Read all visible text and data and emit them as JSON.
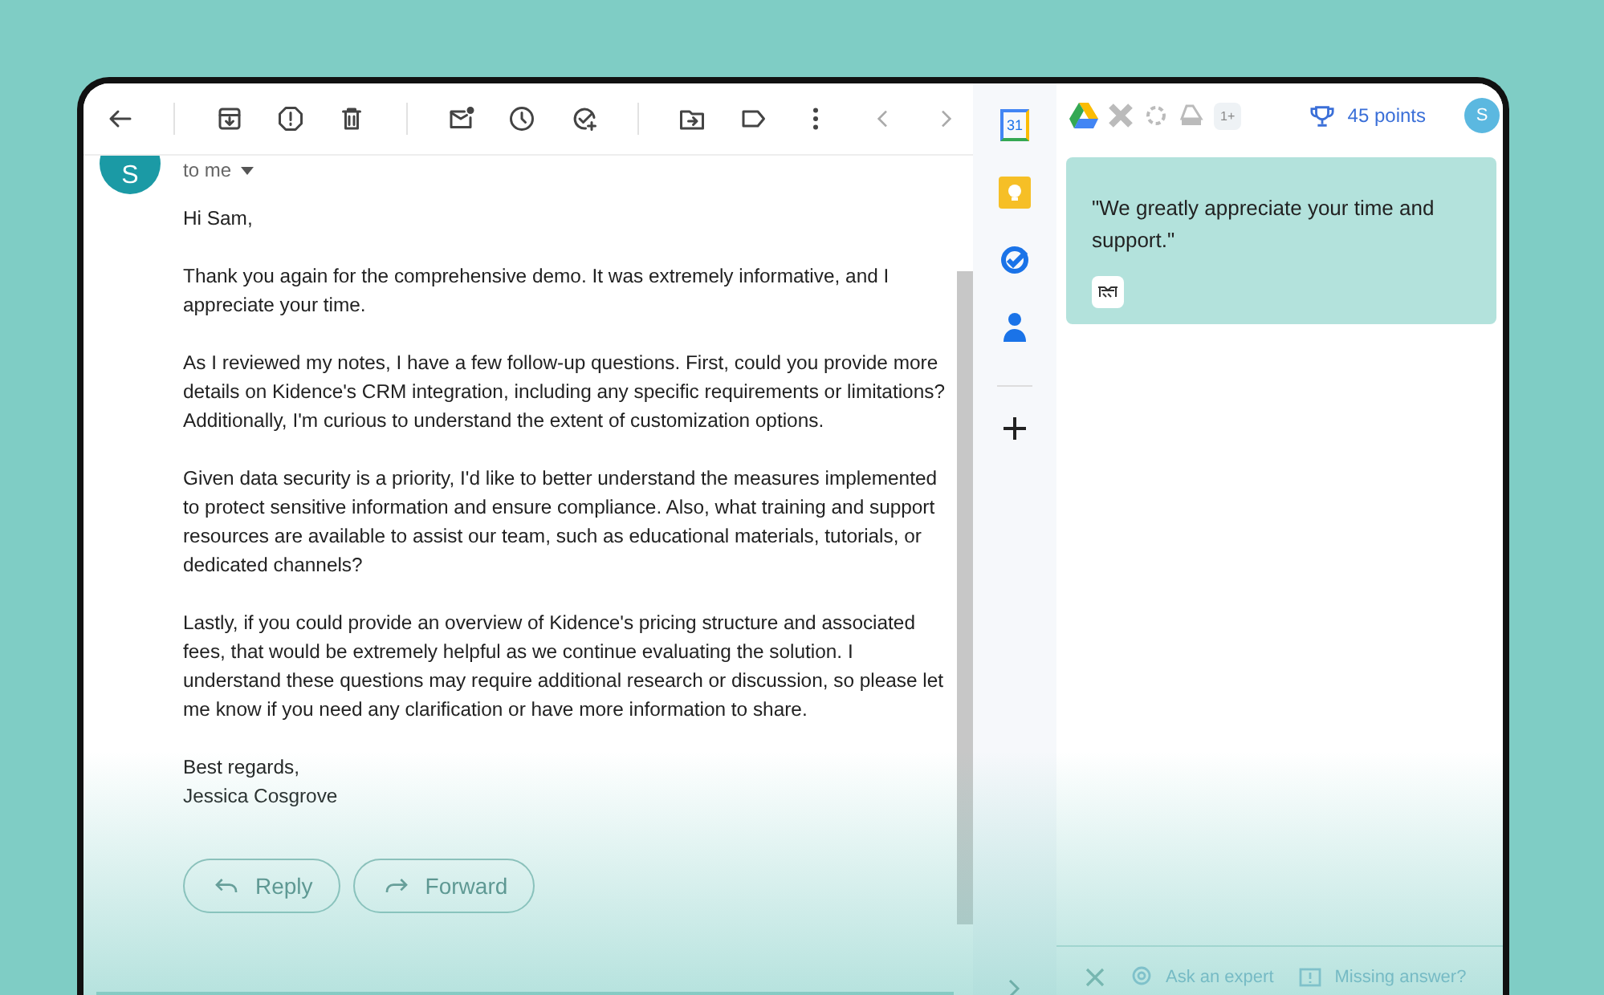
{
  "toolbar": {
    "icons": [
      {
        "kind": "back"
      },
      {
        "kind": "sep"
      },
      {
        "kind": "archive"
      },
      {
        "kind": "spam"
      },
      {
        "kind": "trash"
      },
      {
        "kind": "sep"
      },
      {
        "kind": "unread"
      },
      {
        "kind": "snooze"
      },
      {
        "kind": "task"
      },
      {
        "kind": "sep"
      },
      {
        "kind": "move"
      },
      {
        "kind": "label"
      },
      {
        "kind": "more"
      }
    ]
  },
  "message": {
    "sender_initial": "S",
    "recipient": "to me",
    "greeting": "Hi Sam,",
    "paragraphs": [
      "Thank you again for the comprehensive demo. It was extremely informative, and I appreciate your time.",
      "As I reviewed my notes, I have a few follow-up questions. First, could you provide more details on Kidence's CRM integration, including any specific requirements or limitations? Additionally, I'm curious to understand the extent of customization options.",
      "Given data security is a priority, I'd like to better understand the measures implemented to protect sensitive information and ensure compliance. Also, what training and support resources are available to assist our team, such as educational materials, tutorials, or dedicated channels?",
      "Lastly, if you could provide an overview of Kidence's pricing structure and associated fees, that would be extremely helpful as we continue evaluating the solution. I understand these questions may require additional research or discussion, so please let me know if you need any clarification or have more information to share."
    ],
    "closing": "Best regards,",
    "signature": "Jessica Cosgrove"
  },
  "actions": [
    {
      "kind": "reply",
      "label": "Reply"
    },
    {
      "kind": "forward",
      "label": "Forward"
    }
  ],
  "side_rail": [
    {
      "kind": "calendar",
      "label": "31"
    },
    {
      "kind": "keep"
    },
    {
      "kind": "tasks"
    },
    {
      "kind": "contacts"
    },
    {
      "kind": "add"
    }
  ],
  "panel": {
    "apps_badge": "1+",
    "points": "45 points",
    "avatar": "S",
    "quote": "\"We greatly appreciate your time and support.\"",
    "footer": [
      {
        "kind": "close"
      },
      {
        "kind": "expert",
        "label": "Ask an expert"
      },
      {
        "kind": "missing",
        "label": "Missing answer?"
      }
    ]
  }
}
